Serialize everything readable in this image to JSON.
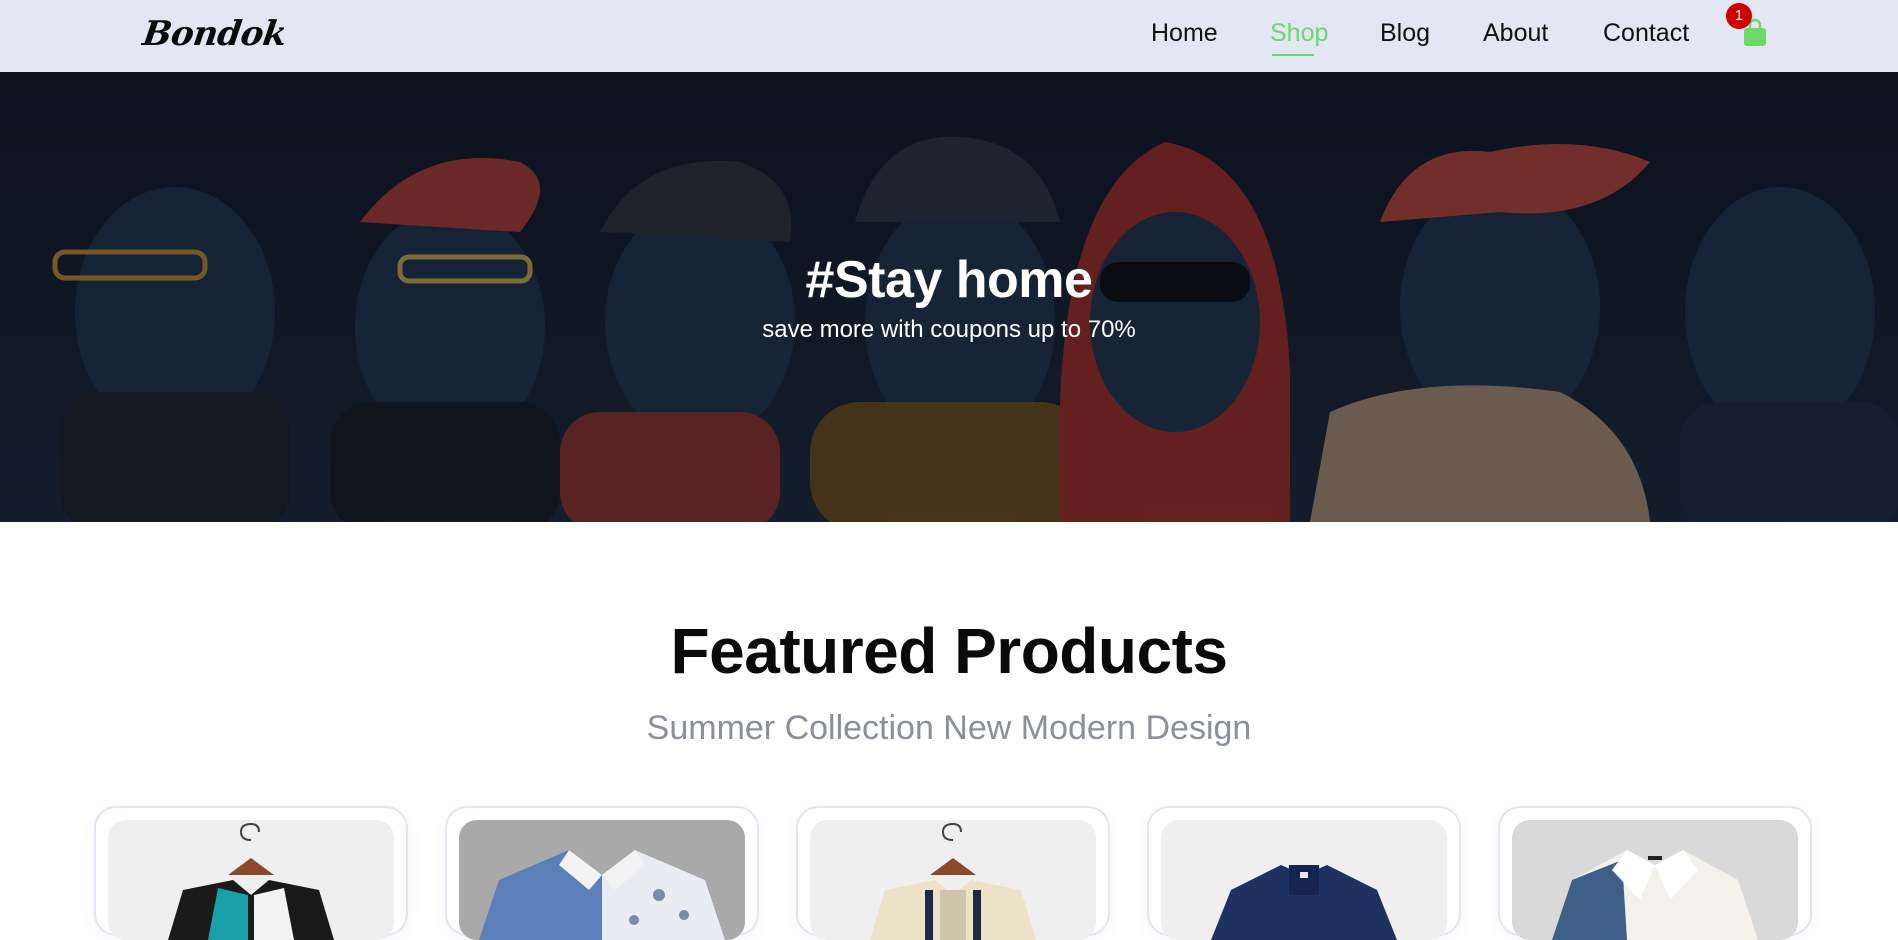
{
  "header": {
    "logo_text": "Bondok",
    "nav": [
      {
        "label": "Home",
        "active": false
      },
      {
        "label": "Shop",
        "active": true
      },
      {
        "label": "Blog",
        "active": false
      },
      {
        "label": "About",
        "active": false
      },
      {
        "label": "Contact",
        "active": false
      }
    ],
    "cart": {
      "icon": "shopping-bag-icon",
      "count": "1"
    }
  },
  "hero": {
    "title": "#Stay home",
    "subtitle": "save more with coupons up to 70%"
  },
  "featured": {
    "title": "Featured Products",
    "subtitle": "Summer Collection New Modern Design",
    "products": [
      {
        "image": "shirt-teal-black-on-hanger"
      },
      {
        "image": "shirt-blue-palm-print"
      },
      {
        "image": "shirt-cream-stripe-on-hanger"
      },
      {
        "image": "shirt-navy-polo"
      },
      {
        "image": "shirt-white-blue-panel"
      }
    ]
  },
  "colors": {
    "header_bg": "#e3e6f3",
    "accent_green": "#6ad96a",
    "badge_red": "#d00000",
    "subtitle_gray": "#8a8f99"
  }
}
